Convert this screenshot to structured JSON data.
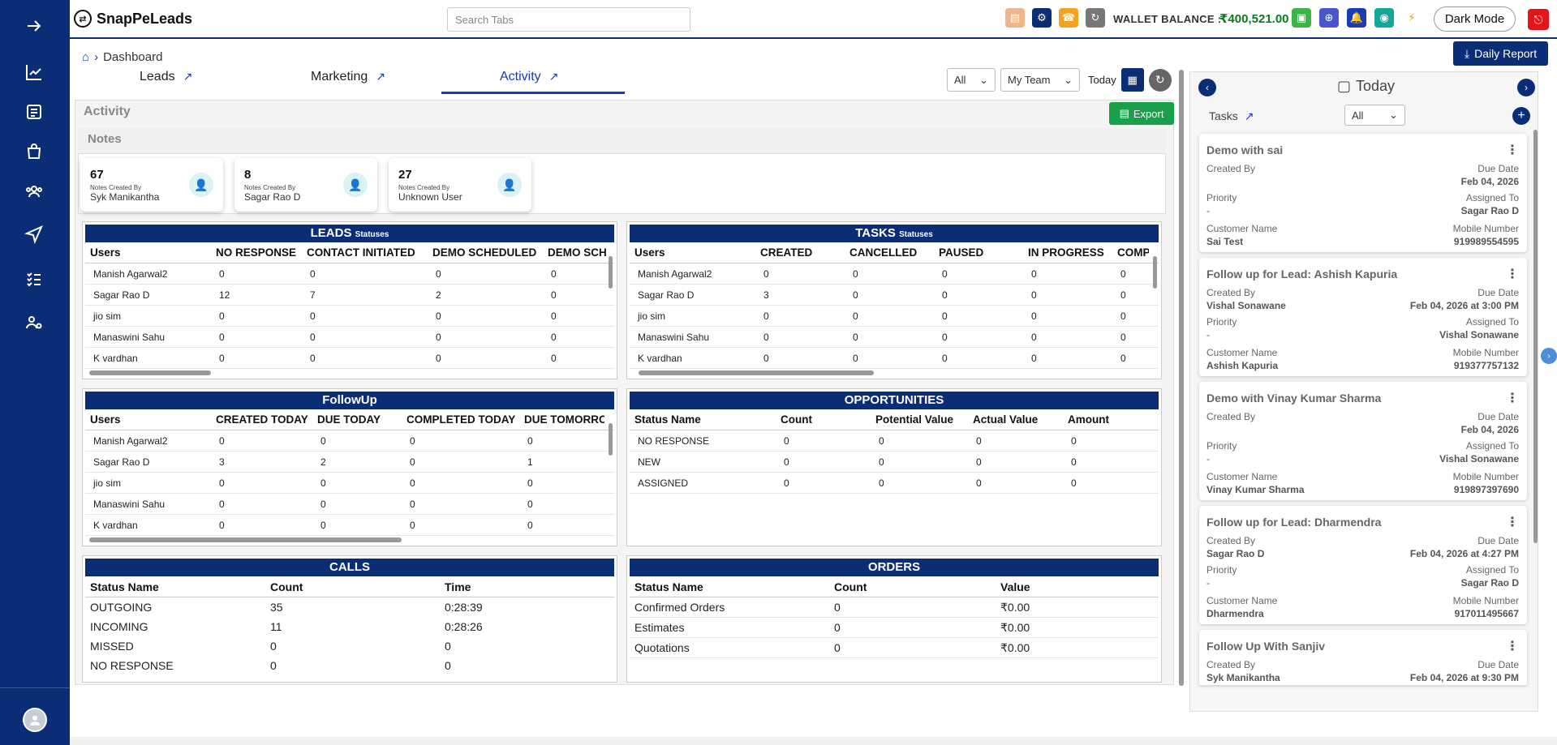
{
  "app": {
    "name": "SnapPeLeads"
  },
  "search": {
    "placeholder": "Search Tabs"
  },
  "header": {
    "wallet_label": "WALLET BALANCE :",
    "wallet_amount": "₹400,521.00",
    "dark_mode": "Dark Mode",
    "daily_report": "Daily Report"
  },
  "breadcrumb": {
    "current": "Dashboard"
  },
  "tabs": [
    {
      "label": "Leads"
    },
    {
      "label": "Marketing"
    },
    {
      "label": "Activity"
    }
  ],
  "filters": {
    "scope": "All",
    "team": "My Team",
    "period": "Today"
  },
  "activity": {
    "title": "Activity",
    "export": "Export"
  },
  "notes": {
    "title": "Notes",
    "cards": [
      {
        "count": "67",
        "sub": "Notes Created By",
        "name": "Syk Manikantha"
      },
      {
        "count": "8",
        "sub": "Notes Created By",
        "name": "Sagar Rao D"
      },
      {
        "count": "27",
        "sub": "Notes Created By",
        "name": "Unknown User"
      }
    ]
  },
  "leads": {
    "title": "LEADS",
    "title_small": "Statuses",
    "headers": [
      "Users",
      "NO RESPONSE",
      "CONTACT INITIATED",
      "DEMO SCHEDULED",
      "DEMO SCH"
    ],
    "rows": [
      [
        "Manish Agarwal2",
        "0",
        "0",
        "0",
        "0"
      ],
      [
        "Sagar Rao D",
        "12",
        "7",
        "2",
        "0"
      ],
      [
        "jio sim",
        "0",
        "0",
        "0",
        "0"
      ],
      [
        "Manaswini Sahu",
        "0",
        "0",
        "0",
        "0"
      ],
      [
        "K vardhan",
        "0",
        "0",
        "0",
        "0"
      ]
    ]
  },
  "tasks_table": {
    "title": "TASKS",
    "title_small": "Statuses",
    "headers": [
      "Users",
      "CREATED",
      "CANCELLED",
      "PAUSED",
      "IN PROGRESS",
      "COMP"
    ],
    "rows": [
      [
        "Manish Agarwal2",
        "0",
        "0",
        "0",
        "0",
        "0"
      ],
      [
        "Sagar Rao D",
        "3",
        "0",
        "0",
        "0",
        "0"
      ],
      [
        "jio sim",
        "0",
        "0",
        "0",
        "0",
        "0"
      ],
      [
        "Manaswini Sahu",
        "0",
        "0",
        "0",
        "0",
        "0"
      ],
      [
        "K vardhan",
        "0",
        "0",
        "0",
        "0",
        "0"
      ]
    ]
  },
  "followup": {
    "title": "FollowUp",
    "headers": [
      "Users",
      "CREATED TODAY",
      "DUE TODAY",
      "COMPLETED TODAY",
      "DUE TOMORRO"
    ],
    "rows": [
      [
        "Manish Agarwal2",
        "0",
        "0",
        "0",
        "0"
      ],
      [
        "Sagar Rao D",
        "3",
        "2",
        "0",
        "1"
      ],
      [
        "jio sim",
        "0",
        "0",
        "0",
        "0"
      ],
      [
        "Manaswini Sahu",
        "0",
        "0",
        "0",
        "0"
      ],
      [
        "K vardhan",
        "0",
        "0",
        "0",
        "0"
      ]
    ]
  },
  "opportunities": {
    "title": "OPPORTUNITIES",
    "headers": [
      "Status Name",
      "Count",
      "Potential Value",
      "Actual Value",
      "Amount"
    ],
    "rows": [
      [
        "NO RESPONSE",
        "0",
        "0",
        "0",
        "0"
      ],
      [
        "NEW",
        "0",
        "0",
        "0",
        "0"
      ],
      [
        "ASSIGNED",
        "0",
        "0",
        "0",
        "0"
      ]
    ]
  },
  "calls": {
    "title": "CALLS",
    "headers": [
      "Status Name",
      "Count",
      "Time"
    ],
    "rows": [
      [
        "OUTGOING",
        "35",
        "0:28:39"
      ],
      [
        "INCOMING",
        "11",
        "0:28:26"
      ],
      [
        "MISSED",
        "0",
        "0"
      ],
      [
        "NO RESPONSE",
        "0",
        "0"
      ]
    ]
  },
  "orders": {
    "title": "ORDERS",
    "headers": [
      "Status Name",
      "Count",
      "Value"
    ],
    "rows": [
      [
        "Confirmed Orders",
        "0",
        "₹0.00"
      ],
      [
        "Estimates",
        "0",
        "₹0.00"
      ],
      [
        "Quotations",
        "0",
        "₹0.00"
      ]
    ]
  },
  "right_panel": {
    "date_label": "Today",
    "tasks_label": "Tasks",
    "filter": "All",
    "labels": {
      "created_by": "Created By",
      "due_date": "Due Date",
      "priority": "Priority",
      "assigned_to": "Assigned To",
      "customer_name": "Customer Name",
      "mobile_number": "Mobile Number"
    },
    "tasks": [
      {
        "title": "Demo with sai",
        "created_by": "",
        "due": "Feb 04, 2026",
        "priority": "-",
        "assigned": "Sagar Rao D",
        "customer": "Sai Test",
        "mobile": "919989554595"
      },
      {
        "title": "Follow up for Lead: Ashish Kapuria",
        "created_by": "Vishal Sonawane",
        "due": "Feb 04, 2026 at 3:00 PM",
        "priority": "-",
        "assigned": "Vishal Sonawane",
        "customer": "Ashish Kapuria",
        "mobile": "919377757132"
      },
      {
        "title": "Demo with Vinay Kumar Sharma",
        "created_by": "",
        "due": "Feb 04, 2026",
        "priority": "-",
        "assigned": "Vishal Sonawane",
        "customer": "Vinay Kumar Sharma",
        "mobile": "919897397690"
      },
      {
        "title": "Follow up for Lead: Dharmendra",
        "created_by": "Sagar Rao D",
        "due": "Feb 04, 2026 at 4:27 PM",
        "priority": "-",
        "assigned": "Sagar Rao D",
        "customer": "Dharmendra",
        "mobile": "917011495667"
      },
      {
        "title": "Follow Up With Sanjiv",
        "created_by": "Syk Manikantha",
        "due": "Feb 04, 2026 at 9:30 PM",
        "priority": "",
        "assigned": "",
        "customer": "",
        "mobile": ""
      }
    ]
  },
  "colors": {
    "primary": "#0b2d75",
    "accent": "#1a3bb3",
    "export": "#19a04b",
    "wallet": "#0a7a1e",
    "logout": "#e3151a"
  }
}
